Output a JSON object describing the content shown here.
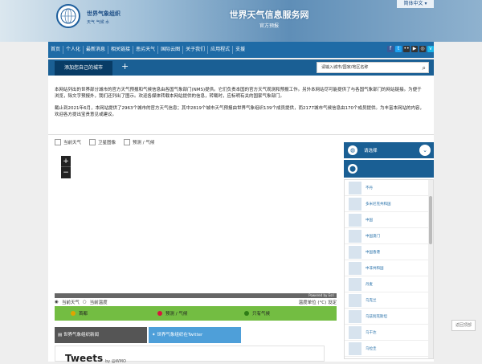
{
  "header": {
    "org_name": "世界气象组织",
    "org_sub": "天气 气候 水",
    "title": "世界天气信息服务网",
    "subtitle": "官方预报",
    "lang": "简体中文 ▾"
  },
  "nav": {
    "items": [
      "首页",
      "个人化",
      "最新消息",
      "相关链接",
      "恶劣天气",
      "国际云图",
      "关于我们",
      "应用程式",
      "支援"
    ],
    "social": [
      {
        "name": "facebook-icon",
        "glyph": "f",
        "color": "#3b5998"
      },
      {
        "name": "twitter-icon",
        "glyph": "t",
        "color": "#1da1f2"
      },
      {
        "name": "flickr-icon",
        "glyph": "••",
        "color": "#333"
      },
      {
        "name": "youtube-icon",
        "glyph": "▶",
        "color": "#333"
      },
      {
        "name": "instagram-icon",
        "glyph": "◎",
        "color": "#333"
      },
      {
        "name": "vimeo-icon",
        "glyph": "v",
        "color": "#1ab7ea"
      }
    ]
  },
  "toolbar": {
    "add_city": "添加您自己的城市",
    "plus": "+",
    "search_placeholder": "请输入城市/国家/地区名称",
    "search_icon": "⌕"
  },
  "intro": {
    "p1": "本网站列出的世界部分城市的官方天气预报和气候信息由各国气象部门(NMS)提供。它们负责本国的官方天气观测和预报工作。另外本网站尽可能提供了与各国气象部门的网站链接。为便于浏览，除文字预报外，我们还列出了图示。欢迎各媒体转载本网站提供的信息，转载时，应标明有关的国家气象部门。",
    "p2": "截止到2021年6月，本网站提供了2963个城市的官方天气信息；其中2819个城市天气预报由世界气象组织139个成员提供，而2177城市气候信息由170个成员提供。为丰富本网站的内容，欢迎各方提出宝贵意见或建议。"
  },
  "checks": [
    "当前天气",
    "卫星图像",
    "预测 / 气候"
  ],
  "map": {
    "zoom_in": "+",
    "zoom_out": "−",
    "powered": "Powered by Esri"
  },
  "radios": {
    "current_weather": "当前天气",
    "current_temp": "当前温度",
    "units_label": "温度单位 (°C) 设定"
  },
  "legend": [
    {
      "label": "首都",
      "color": "#e0a400"
    },
    {
      "label": "预测 / 气候",
      "color": "#d9143d"
    },
    {
      "label": "只有气候",
      "color": "#2e7d16"
    }
  ],
  "tabs": {
    "news": "世界气象组织新闻",
    "twitter": "世界气象组织在Twitter"
  },
  "tweets": {
    "title": "Tweets",
    "by": "by @WMO"
  },
  "sidebar": {
    "select_label": "请选择",
    "items": [
      "不丹",
      "多米尼克共和国",
      "中国",
      "中国澳门",
      "中国香港",
      "中非共和国",
      "丹麦",
      "乌克兰",
      "乌兹别克斯坦",
      "乌干达",
      "乌拉圭",
      "乍得"
    ]
  },
  "back_to_top": "返回顶部"
}
